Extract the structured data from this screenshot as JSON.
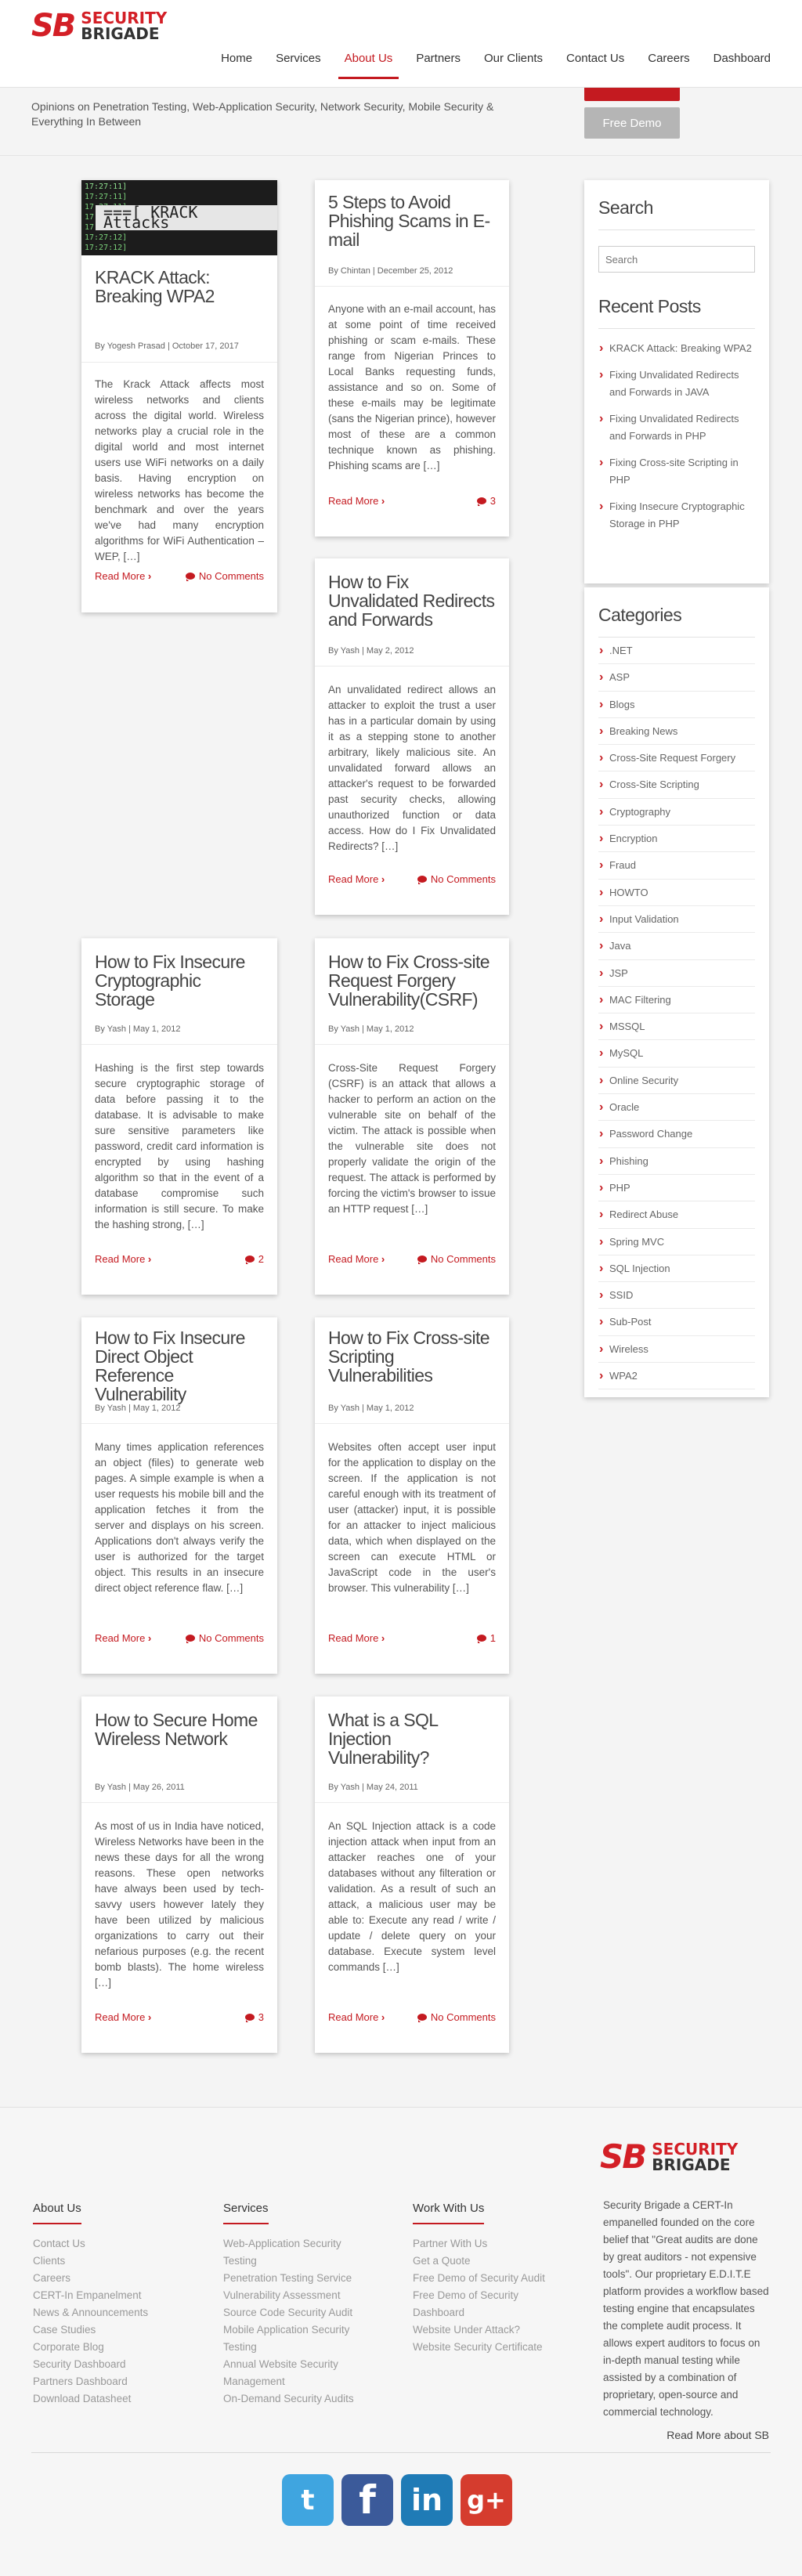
{
  "header": {
    "logo_mark": "SB",
    "logo_line1": "SECURITY",
    "logo_line2": "BRIGADE",
    "nav": [
      "Home",
      "Services",
      "About Us",
      "Partners",
      "Our Clients",
      "Contact Us",
      "Careers",
      "Dashboard"
    ],
    "active_nav": "About Us"
  },
  "hero": {
    "subtitle": "Opinions on Penetration Testing, Web-Application Security, Network Security, Mobile Security & Everything In Between",
    "demo_button": "Free Demo"
  },
  "posts": [
    {
      "title": "KRACK Attack: Breaking WPA2",
      "meta": "By Yogesh Prasad | October 17, 2017",
      "excerpt": "The Krack Attack affects most wireless networks and clients across the digital world. Wireless networks play a crucial role in the digital world and most internet users use WiFi networks on a daily basis. Having encryption on wireless networks has become the benchmark and over the years we've had many encryption algorithms for WiFi Authentication – WEP, […]",
      "read_more": "Read More",
      "comments": "No Comments",
      "thumb_label": "===[ KRACK Attacks"
    },
    {
      "title": "5 Steps to Avoid Phishing Scams in E-mail",
      "meta": "By Chintan | December 25, 2012",
      "excerpt": "Anyone with an e-mail account, has at some point of time received phishing or scam e-mails. These range from Nigerian Princes to Local Banks requesting funds, assistance and so on. Some of these e-mails may be legitimate (sans the Nigerian prince), however most of these are a common technique known as phishing. Phishing scams are […]",
      "read_more": "Read More",
      "comments": "3"
    },
    {
      "title": "How to Fix Unvalidated Redirects and Forwards",
      "meta": "By Yash | May 2, 2012",
      "excerpt": "An unvalidated redirect allows an attacker to exploit the trust a user has in a particular domain by using it as a stepping stone to another arbitrary, likely malicious site. An unvalidated forward allows an attacker's request to be forwarded past security checks, allowing unauthorized function or data access. How do I Fix Unvalidated Redirects? […]",
      "read_more": "Read More",
      "comments": "No Comments"
    },
    {
      "title": "How to Fix Insecure Cryptographic Storage",
      "meta": "By Yash | May 1, 2012",
      "excerpt": "Hashing is the first step towards secure cryptographic storage of data before passing it to the database. It is advisable to make sure sensitive parameters like password, credit card information is encrypted by using hashing algorithm so that in the event of a database compromise such information is still secure. To make the hashing strong, […]",
      "read_more": "Read More",
      "comments": "2"
    },
    {
      "title": "How to Fix Cross-site Request Forgery Vulnerability(CSRF)",
      "meta": "By Yash | May 1, 2012",
      "excerpt": "Cross-Site Request Forgery (CSRF) is an attack that allows a hacker to perform an action on the vulnerable site on behalf of the victim. The attack is possible when the vulnerable site does not properly validate the origin of the request. The attack is performed by forcing the victim's browser to issue an HTTP request […]",
      "read_more": "Read More",
      "comments": "No Comments"
    },
    {
      "title": "How to Fix Insecure Direct Object Reference Vulnerability",
      "meta": "By Yash | May 1, 2012",
      "excerpt": "Many times application references an object (files) to generate web pages. A simple example is when a user requests his mobile bill and the application fetches it from the server and displays on his screen. Applications don't always verify the user is authorized for the target object. This results in an insecure direct object reference flaw. […]",
      "read_more": "Read More",
      "comments": "No Comments"
    },
    {
      "title": "How to Fix Cross-site Scripting Vulnerabilities",
      "meta": "By Yash | May 1, 2012",
      "excerpt": "Websites often accept user input for the application to display on the screen. If the application is not careful enough with its treatment of user (attacker) input, it is possible for an attacker to inject malicious data, which when displayed on the screen can execute HTML or JavaScript code in the user's browser. This vulnerability […]",
      "read_more": "Read More",
      "comments": "1"
    },
    {
      "title": "How to Secure Home Wireless Network",
      "meta": "By Yash | May 26, 2011",
      "excerpt": "As most of us in India have noticed, Wireless Networks have been in the news these days for all the wrong reasons. These open networks have always been used by tech-savvy users however lately they have been utilized by malicious organizations to carry out their nefarious purposes (e.g. the recent bomb blasts). The home wireless […]",
      "read_more": "Read More",
      "comments": "3"
    },
    {
      "title": "What is a SQL Injection Vulnerability?",
      "meta": "By Yash | May 24, 2011",
      "excerpt": "An SQL Injection attack is a code injection attack when input from an attacker reaches one of your databases without any filteration or validation. As a result of such an attack, a malicious user may be able to: Execute any read / write / update / delete query on your database. Execute system level commands […]",
      "read_more": "Read More",
      "comments": "No Comments"
    }
  ],
  "sidebar": {
    "search_title": "Search",
    "search_placeholder": "Search",
    "recent_title": "Recent Posts",
    "recent": [
      "KRACK Attack: Breaking WPA2",
      "Fixing Unvalidated Redirects and Forwards in JAVA",
      "Fixing Unvalidated Redirects and Forwards in PHP",
      "Fixing Cross-site Scripting in PHP",
      "Fixing Insecure Cryptographic Storage in PHP"
    ],
    "categories_title": "Categories",
    "categories": [
      ".NET",
      "ASP",
      "Blogs",
      "Breaking News",
      "Cross-Site Request Forgery",
      "Cross-Site Scripting",
      "Cryptography",
      "Encryption",
      "Fraud",
      "HOWTO",
      "Input Validation",
      "Java",
      "JSP",
      "MAC Filtering",
      "MSSQL",
      "MySQL",
      "Online Security",
      "Oracle",
      "Password Change",
      "Phishing",
      "PHP",
      "Redirect Abuse",
      "Spring MVC",
      "SQL Injection",
      "SSID",
      "Sub-Post",
      "Wireless",
      "WPA2"
    ]
  },
  "footer": {
    "col1_title": "About Us",
    "col1": [
      "Contact Us",
      "Clients",
      "Careers",
      "CERT-In Empanelment",
      "News & Announcements",
      "Case Studies",
      "Corporate Blog",
      "Security Dashboard",
      "Partners Dashboard",
      "Download Datasheet"
    ],
    "col2_title": "Services",
    "col2": [
      "Web-Application Security",
      "Testing",
      "Penetration Testing Service",
      "Vulnerability Assessment",
      "Source Code Security Audit",
      "Mobile Application Security",
      "Testing",
      "Annual Website Security",
      "Management",
      "On-Demand Security Audits"
    ],
    "col3_title": "Work With Us",
    "col3": [
      "Partner With Us",
      "Get a Quote",
      "Free Demo of Security Audit",
      "Free Demo of Security",
      "Dashboard",
      "Website Under Attack?",
      "Website Security Certificate"
    ],
    "about": "Security Brigade a CERT-In empanelled founded on the core belief that \"Great audits are done by great auditors - not expensive tools\". Our proprietary E.D.I.T.E platform provides a workflow based testing engine that encapsulates the complete audit process. It allows expert auditors to focus on in-depth manual testing while assisted by a combination of proprietary, open-source and commercial technology.",
    "read_more": "Read More about SB",
    "social": [
      {
        "name": "twitter",
        "glyph": "t"
      },
      {
        "name": "facebook",
        "glyph": "f"
      },
      {
        "name": "linkedin",
        "glyph": "in"
      },
      {
        "name": "google-plus",
        "glyph": "g+"
      }
    ]
  },
  "colors": {
    "accent": "#c41a20",
    "brand": "#d31f26"
  }
}
